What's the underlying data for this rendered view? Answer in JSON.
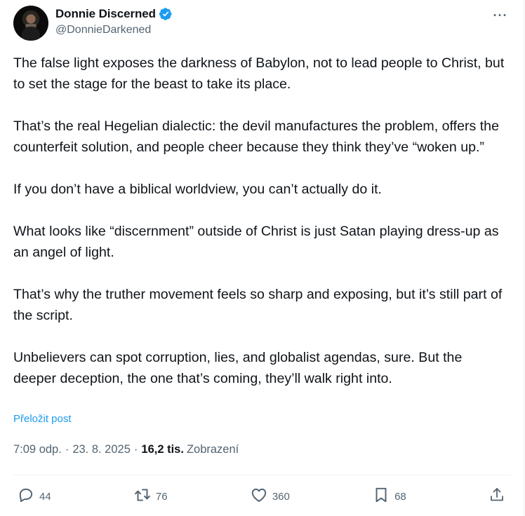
{
  "author": {
    "display_name": "Donnie Discerned",
    "handle": "@DonnieDarkened",
    "verified_icon": "verified-badge-icon",
    "accent_color": "#1d9bf0"
  },
  "more_icon": "more-options-icon",
  "tweet": {
    "paragraphs": [
      "The false light exposes the darkness of Babylon, not to lead people to Christ, but to set the stage for the beast to take its place.",
      "That’s the real Hegelian dialectic: the devil manufactures the problem, offers the counterfeit solution, and people cheer because they think they’ve “woken up.”",
      "If you don’t have a biblical worldview, you can’t actually do it.",
      "What looks like “discernment” outside of Christ is just Satan playing dress-up as an angel of light.",
      "That’s why the truther movement feels so sharp and exposing, but it’s still part of the script.",
      "Unbelievers can spot corruption, lies, and globalist agendas, sure. But the deeper deception, the one that’s coming, they’ll walk right into."
    ],
    "translate_label": "Přeložit post",
    "time": "7:09 odp.",
    "date": "23. 8. 2025",
    "views_count": "16,2 tis.",
    "views_label": "Zobrazení"
  },
  "actions": {
    "replies": "44",
    "reposts": "76",
    "likes": "360",
    "bookmarks": "68"
  }
}
